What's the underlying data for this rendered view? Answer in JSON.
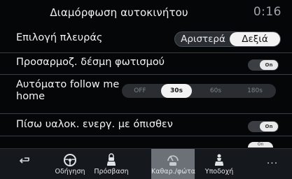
{
  "header": {
    "title": "Διαμόρφωση αυτοκινήτου",
    "clock": "0:16"
  },
  "rows": {
    "side": {
      "label": "Επιλογή πλευράς",
      "options": [
        "Αριστερά",
        "Δεξιά"
      ],
      "selected": "Δεξιά"
    },
    "headlight": {
      "label": "Προσαρμοζ. δέσμη φωτισμού",
      "toggle": "On"
    },
    "follow_me": {
      "label_line1": "Αυτόματο follow me",
      "label_line2": "home",
      "options": [
        "OFF",
        "30s",
        "60s",
        "180s"
      ],
      "selected": "30s"
    },
    "rear_wiper": {
      "label": "Πίσω υαλοκ. ενεργ. με όπισθεν",
      "toggle": "On"
    },
    "next": {
      "toggle": "On"
    }
  },
  "nav": {
    "items": [
      {
        "label": "",
        "icon": "back-arrow-icon"
      },
      {
        "label": "Οδήγηση",
        "icon": "steering-wheel-icon"
      },
      {
        "label": "Πρόσβαση",
        "icon": "car-lock-icon"
      },
      {
        "label": "Καθαρ./φώτα",
        "icon": "wiper-lights-icon"
      },
      {
        "label": "Υποδοχή",
        "icon": "person-car-icon"
      },
      {
        "label": "",
        "icon": "more-dots-icon"
      }
    ],
    "active_index": 3
  },
  "colors": {
    "background": "#050607",
    "navbar": "#15181c",
    "active_tab": "#6b7177",
    "selected_pill": "#f2f2f2"
  }
}
